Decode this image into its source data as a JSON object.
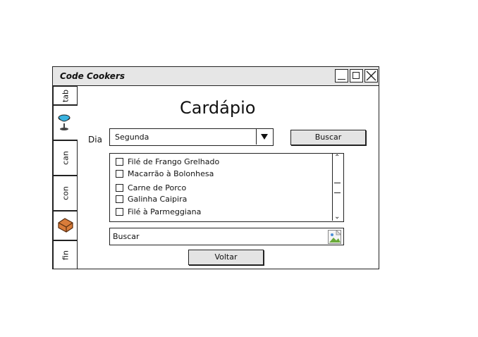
{
  "window": {
    "title": "Code Cookers"
  },
  "tabs": [
    {
      "label": "tab",
      "icon": ""
    },
    {
      "label": "",
      "icon": "cocktail-glass-icon"
    },
    {
      "label": "can",
      "icon": ""
    },
    {
      "label": "con",
      "icon": ""
    },
    {
      "label": "",
      "icon": "brick-icon"
    },
    {
      "label": "fin",
      "icon": ""
    }
  ],
  "page": {
    "title": "Cardápio"
  },
  "form": {
    "day_label": "Dia",
    "day_value": "Segunda",
    "search_button": "Buscar"
  },
  "menu_items": [
    {
      "label": "Filé de Frango Grelhado",
      "checked": false
    },
    {
      "label": "Macarrão à Bolonhesa",
      "checked": false
    },
    {
      "label": "Carne de Porco",
      "checked": false
    },
    {
      "label": "Galinha Caipira",
      "checked": false
    },
    {
      "label": "Filé à Parmeggiana",
      "checked": false
    }
  ],
  "search": {
    "text": "Buscar"
  },
  "footer": {
    "back_button": "Voltar"
  }
}
